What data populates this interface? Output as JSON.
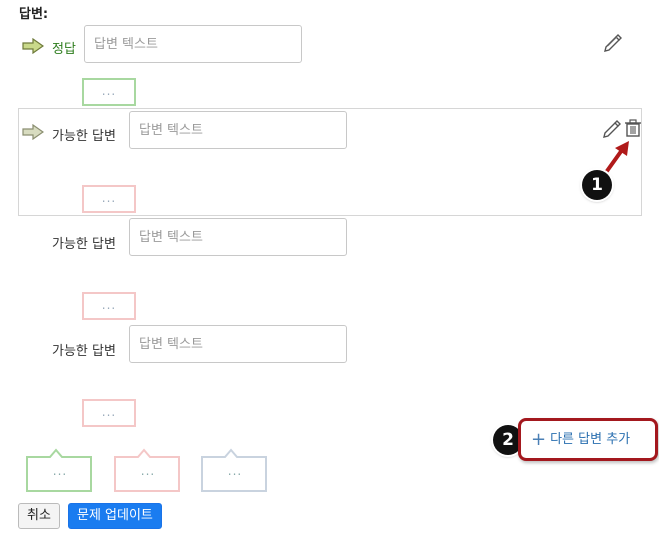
{
  "section": {
    "heading": "답변:"
  },
  "answers": [
    {
      "label": "정답",
      "placeholder": "답변 텍스트",
      "type": "correct"
    },
    {
      "label": "가능한 답변",
      "placeholder": "답변 텍스트",
      "type": "possible"
    },
    {
      "label": "가능한 답변",
      "placeholder": "답변 텍스트",
      "type": "possible"
    },
    {
      "label": "가능한 답변",
      "placeholder": "답변 텍스트",
      "type": "possible"
    }
  ],
  "feedback_placeholder": "...",
  "badges": {
    "one": "1",
    "two": "2"
  },
  "add_answer": {
    "plus": "+",
    "label": "다른 답변 추가"
  },
  "feedback_types": [
    {
      "text": "...",
      "color": "#a8d8a0"
    },
    {
      "text": "...",
      "color": "#f4c7c7"
    },
    {
      "text": "...",
      "color": "#c9d3df"
    }
  ],
  "buttons": {
    "cancel": "취소",
    "update": "문제 업데이트"
  },
  "colors": {
    "correct_label": "#2e7d1e",
    "add_answer_border": "#a3181e",
    "add_answer_text": "#2a6fb0",
    "primary": "#1a7cf0",
    "annotation_arrow": "#b01a1a"
  },
  "icons": {
    "answer_arrow": "right-arrow-icon",
    "edit": "pencil-icon",
    "delete": "trash-icon"
  }
}
